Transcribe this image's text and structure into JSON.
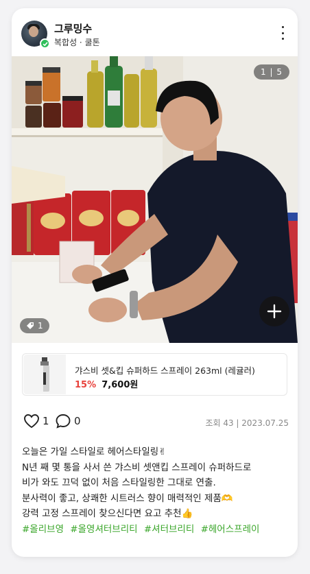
{
  "header": {
    "username": "그루밍수",
    "subtitle": "복합성 · 쿨톤"
  },
  "photo": {
    "counter": "1 | 5",
    "tag_count": "1"
  },
  "product": {
    "name": "갸스비 셋&킵 슈퍼하드 스프레이 263ml (레귤러)",
    "discount": "15%",
    "price": "7,600원"
  },
  "actions": {
    "likes": "1",
    "comments": "0",
    "meta": "조회 43 | 2023.07.25"
  },
  "post": {
    "lines": [
      "오늘은 가일 스타일로 헤어스타일링✌",
      "N년 째 몇 통을 사서 쓴 갸스비 셋앤킵 스프레이 슈퍼하드로",
      "비가 와도 끄덕 없이 처음 스타일링한 그대로 연출.",
      "분사력이 좋고, 상쾌한 시트러스 향이 매력적인 제품🫶",
      "강력 고정 스프레이 찾으신다면 요고 추천👍"
    ],
    "hashtags": [
      "#올리브영",
      "#올영셔터브리티",
      "#셔터브리티",
      "#헤어스프레이"
    ]
  },
  "colors": {
    "discount": "#e8423c",
    "hashtag": "#3aa62a",
    "verified": "#2fbf5b"
  },
  "icons": [
    "more-vertical-icon",
    "verified-check-icon",
    "tag-icon",
    "plus-icon",
    "heart-icon",
    "comment-icon",
    "spray-bottle-icon"
  ]
}
